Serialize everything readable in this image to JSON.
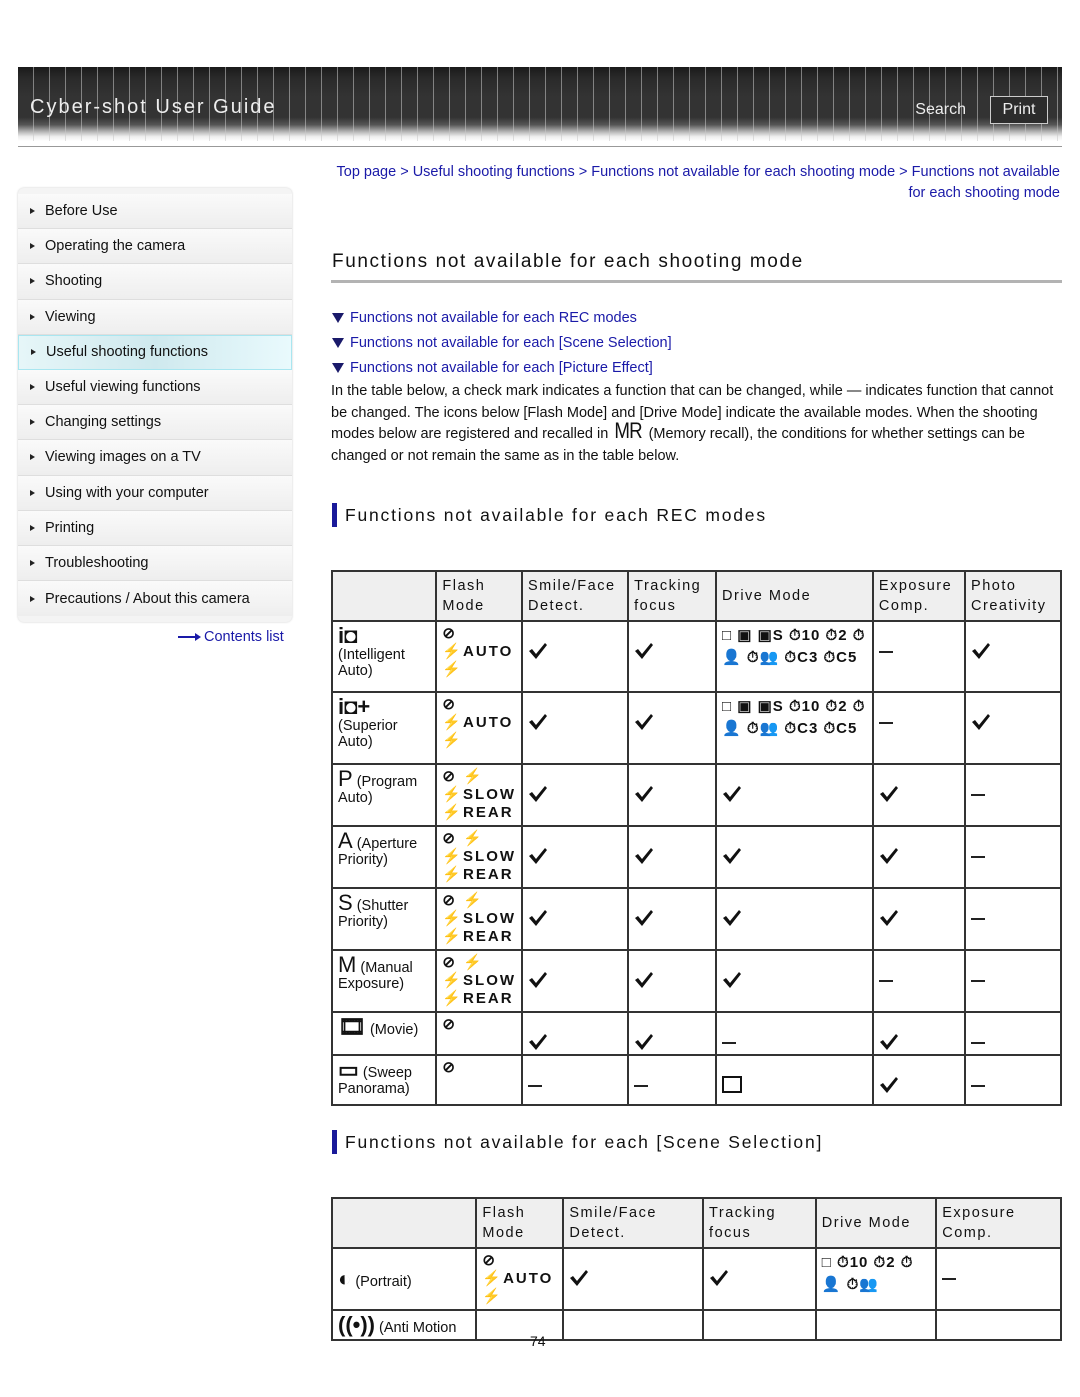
{
  "header": {
    "title": "Cyber-shot User Guide",
    "search_label": "Search",
    "print_label": "Print"
  },
  "sidebar": {
    "items": [
      {
        "label": "Before Use",
        "active": false
      },
      {
        "label": "Operating the camera",
        "active": false
      },
      {
        "label": "Shooting",
        "active": false
      },
      {
        "label": "Viewing",
        "active": false
      },
      {
        "label": "Useful shooting functions",
        "active": true
      },
      {
        "label": "Useful viewing functions",
        "active": false
      },
      {
        "label": "Changing settings",
        "active": false
      },
      {
        "label": "Viewing images on a TV",
        "active": false
      },
      {
        "label": "Using with your computer",
        "active": false
      },
      {
        "label": "Printing",
        "active": false
      },
      {
        "label": "Troubleshooting",
        "active": false
      },
      {
        "label": "Precautions / About this camera",
        "active": false
      }
    ],
    "contents_link": "Contents list"
  },
  "breadcrumb": {
    "items": [
      "Top page",
      "Useful shooting functions",
      "Functions not available for each shooting mode",
      "Functions not available for each shooting mode"
    ],
    "separator": ">"
  },
  "page_title": "Functions not available for each shooting mode",
  "anchor_links": [
    "Functions not available for each REC modes",
    "Functions not available for each [Scene Selection]",
    "Functions not available for each [Picture Effect]"
  ],
  "intro": {
    "line1": "In the table below, a check mark indicates a function that can be changed, while — indicates function that cannot be changed. The icons below [Flash Mode] and [Drive Mode] indicate the available modes. When the shooting modes below are registered and recalled in",
    "mr_symbol": "MR",
    "line2": "(Memory recall), the conditions for whether settings can be changed or not remain the same as in the table below."
  },
  "rec_modes": {
    "title": "Functions not available for each REC modes",
    "headers": [
      "",
      "Flash Mode",
      "Smile/Face Detect.",
      "Tracking focus",
      "Drive Mode",
      "Exposure Comp.",
      "Photo Creativity"
    ],
    "rows": [
      {
        "symbol": "i◘",
        "symbol_icon": "intelligent-auto-icon",
        "label": "(Intelligent Auto)",
        "flash": "⊘ ⚡AUTO ⚡",
        "smile": "check",
        "tracking": "check",
        "drive": "□ ▣ ▣S ⏱10 ⏱2 ⏱👤 ⏱👥 ⏱C3 ⏱C5",
        "exposure": "dash",
        "creativity": "check"
      },
      {
        "symbol": "i◘+",
        "symbol_icon": "superior-auto-icon",
        "label": "(Superior Auto)",
        "flash": "⊘ ⚡AUTO ⚡",
        "smile": "check",
        "tracking": "check",
        "drive": "□ ▣ ▣S ⏱10 ⏱2 ⏱👤 ⏱👥 ⏱C3 ⏱C5",
        "exposure": "dash",
        "creativity": "check"
      },
      {
        "symbol": "P",
        "symbol_icon": "program-auto-icon",
        "label": "(Program Auto)",
        "flash": "⊘ ⚡ ⚡SLOW ⚡REAR",
        "smile": "check",
        "tracking": "check",
        "drive": "check",
        "exposure": "check",
        "creativity": "dash"
      },
      {
        "symbol": "A",
        "symbol_icon": "aperture-priority-icon",
        "label": "(Aperture Priority)",
        "flash": "⊘ ⚡ ⚡SLOW ⚡REAR",
        "smile": "check",
        "tracking": "check",
        "drive": "check",
        "exposure": "check",
        "creativity": "dash"
      },
      {
        "symbol": "S",
        "symbol_icon": "shutter-priority-icon",
        "label": "(Shutter Priority)",
        "flash": "⊘ ⚡ ⚡SLOW ⚡REAR",
        "smile": "check",
        "tracking": "check",
        "drive": "check",
        "exposure": "check",
        "creativity": "dash"
      },
      {
        "symbol": "M",
        "symbol_icon": "manual-exposure-icon",
        "label": "(Manual Exposure)",
        "flash": "⊘ ⚡ ⚡SLOW ⚡REAR",
        "smile": "check",
        "tracking": "check",
        "drive": "check",
        "exposure": "dash",
        "creativity": "dash"
      },
      {
        "symbol": "🎞",
        "symbol_icon": "movie-icon",
        "label": "(Movie)",
        "flash": "⊘",
        "smile": "check",
        "tracking": "check",
        "drive": "dash",
        "exposure": "check",
        "creativity": "dash"
      },
      {
        "symbol": "▭",
        "symbol_icon": "sweep-panorama-icon",
        "label": "(Sweep Panorama)",
        "flash": "⊘",
        "smile": "dash",
        "tracking": "dash",
        "drive": "single",
        "exposure": "check",
        "creativity": "dash"
      }
    ]
  },
  "scene_selection": {
    "title": "Functions not available for each [Scene Selection]",
    "headers": [
      "",
      "Flash Mode",
      "Smile/Face Detect.",
      "Tracking focus",
      "Drive Mode",
      "Exposure Comp."
    ],
    "rows": [
      {
        "symbol_icon": "portrait-icon",
        "label": "(Portrait)",
        "flash": "⊘ ⚡AUTO ⚡",
        "smile": "check",
        "tracking": "check",
        "drive": "□ ⏱10 ⏱2 ⏱👤 ⏱👥",
        "exposure": "dash"
      },
      {
        "symbol_icon": "anti-motion-blur-icon",
        "label": "(Anti Motion",
        "flash": "",
        "smile": "",
        "tracking": "",
        "drive": "",
        "exposure": ""
      }
    ]
  },
  "page_number": "74"
}
